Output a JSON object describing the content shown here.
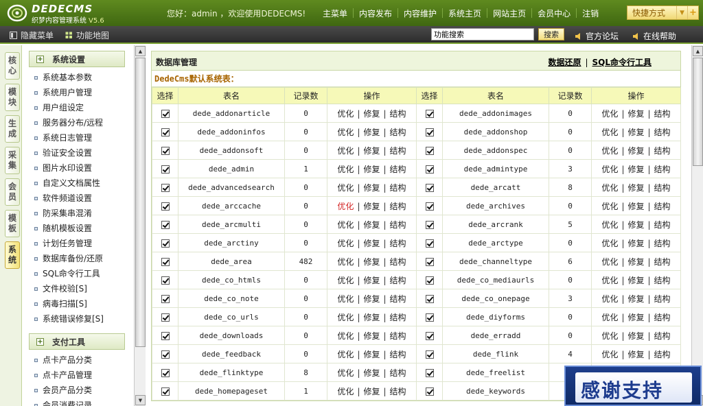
{
  "header": {
    "logo_main": "DEDECMS",
    "logo_sub": "织梦内容管理系统",
    "logo_version": "V5.6",
    "greeting": "您好：admin ，欢迎使用DEDECMS!",
    "nav": [
      "主菜单",
      "内容发布",
      "内容维护",
      "系统主页",
      "网站主页",
      "会员中心",
      "注销"
    ],
    "quick_label": "快捷方式",
    "quick_plus": "+",
    "quick_arrow": "▼"
  },
  "subbar": {
    "hide_menu": "隐藏菜单",
    "func_map": "功能地图",
    "search_value": "功能搜索",
    "search_button": "搜索",
    "forum": "官方论坛",
    "help": "在线帮助"
  },
  "vtabs": [
    "核心",
    "模块",
    "生成",
    "采集",
    "会员",
    "模板",
    "系统"
  ],
  "vtab_active_index": 6,
  "sidebar": {
    "groups": [
      {
        "title": "系统设置",
        "plus": "+",
        "items": [
          "系统基本参数",
          "系统用户管理",
          "用户组设定",
          "服务器分布/远程",
          "系统日志管理",
          "验证安全设置",
          "图片水印设置",
          "自定义文档属性",
          "软件频道设置",
          "防采集串混淆",
          "随机模板设置",
          "计划任务管理",
          "数据库备份/还原",
          "SQL命令行工具",
          "文件校验[S]",
          "病毒扫描[S]",
          "系统错误修复[S]"
        ]
      },
      {
        "title": "支付工具",
        "plus": "+",
        "items": [
          "点卡产品分类",
          "点卡产品管理",
          "会员产品分类",
          "会员消费记录"
        ]
      }
    ]
  },
  "scrollbar": {
    "up": "▲",
    "down": "▼"
  },
  "main": {
    "title": "数据库管理",
    "link_restore": "数据还原",
    "link_sep": "|",
    "link_sql": "SQL命令行工具",
    "sys_tables_label": "DedeCms默认系统表：",
    "headers": [
      "选择",
      "表名",
      "记录数",
      "操作",
      "选择",
      "表名",
      "记录数",
      "操作"
    ],
    "ops": [
      "优化",
      "修复",
      "结构"
    ],
    "op_sep": "|",
    "rows": [
      [
        [
          "dede_addonarticle",
          "0"
        ],
        [
          "dede_addonimages",
          "0"
        ]
      ],
      [
        [
          "dede_addoninfos",
          "0"
        ],
        [
          "dede_addonshop",
          "0"
        ]
      ],
      [
        [
          "dede_addonsoft",
          "0"
        ],
        [
          "dede_addonspec",
          "0"
        ]
      ],
      [
        [
          "dede_admin",
          "1"
        ],
        [
          "dede_admintype",
          "3"
        ]
      ],
      [
        [
          "dede_advancedsearch",
          "0"
        ],
        [
          "dede_arcatt",
          "8"
        ]
      ],
      [
        [
          "dede_arccache",
          "0"
        ],
        [
          "dede_archives",
          "0"
        ]
      ],
      [
        [
          "dede_arcmulti",
          "0"
        ],
        [
          "dede_arcrank",
          "5"
        ]
      ],
      [
        [
          "dede_arctiny",
          "0"
        ],
        [
          "dede_arctype",
          "0"
        ]
      ],
      [
        [
          "dede_area",
          "482"
        ],
        [
          "dede_channeltype",
          "6"
        ]
      ],
      [
        [
          "dede_co_htmls",
          "0"
        ],
        [
          "dede_co_mediaurls",
          "0"
        ]
      ],
      [
        [
          "dede_co_note",
          "0"
        ],
        [
          "dede_co_onepage",
          "3"
        ]
      ],
      [
        [
          "dede_co_urls",
          "0"
        ],
        [
          "dede_diyforms",
          "0"
        ]
      ],
      [
        [
          "dede_downloads",
          "0"
        ],
        [
          "dede_erradd",
          "0"
        ]
      ],
      [
        [
          "dede_feedback",
          "0"
        ],
        [
          "dede_flink",
          "4"
        ]
      ],
      [
        [
          "dede_flinktype",
          "8"
        ],
        [
          "dede_freelist",
          "0"
        ]
      ],
      [
        [
          "dede_homepageset",
          "1"
        ],
        [
          "dede_keywords",
          "0"
        ]
      ]
    ],
    "highlight_op": {
      "row": 5,
      "side": 0,
      "op": 0,
      "color": "#d22222"
    }
  },
  "overlay": {
    "text": "感谢支持"
  },
  "colors": {
    "header_green": "#4f7a18",
    "accent_yellow": "#f2dc7c",
    "table_header": "#f6f9b8",
    "panel_head": "#eef5dc",
    "label_orange": "#a86400"
  }
}
